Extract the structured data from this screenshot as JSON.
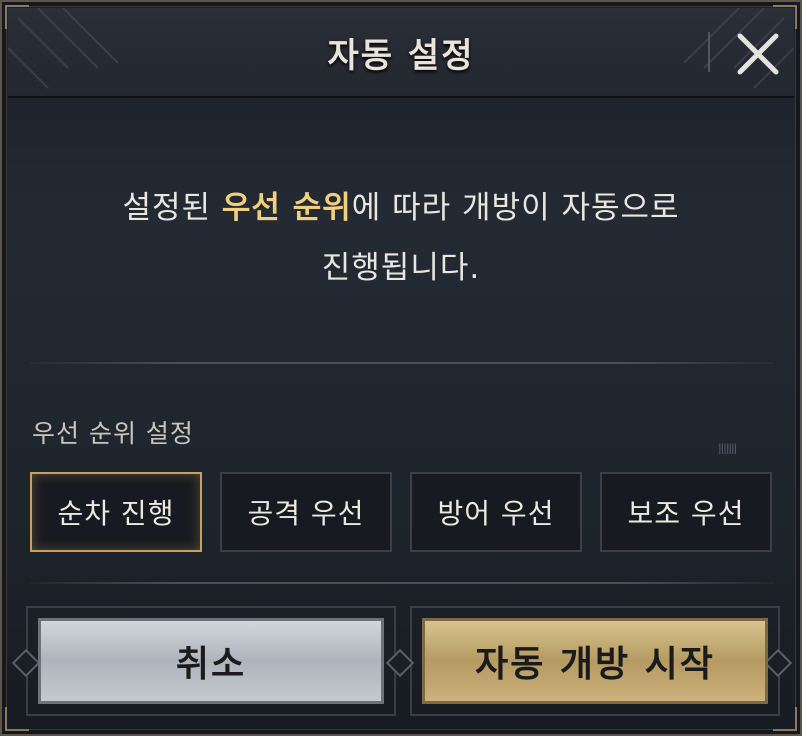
{
  "dialog": {
    "title": "자동 설정",
    "close_icon": "close-icon"
  },
  "message": {
    "before": "설정된 ",
    "highlight": "우선 순위",
    "after": "에 따라 개방이 자동으로",
    "line2": "진행됩니다."
  },
  "priority": {
    "label": "우선 순위 설정",
    "deco": "ꞁꞁꞁꞁꞁꞁꞁ",
    "options": [
      {
        "label": "순차 진행",
        "selected": true
      },
      {
        "label": "공격 우선",
        "selected": false
      },
      {
        "label": "방어 우선",
        "selected": false
      },
      {
        "label": "보조 우선",
        "selected": false
      }
    ]
  },
  "actions": {
    "cancel_label": "취소",
    "start_label": "자동 개방 시작"
  },
  "colors": {
    "highlight": "#f3cf7d",
    "selected_border": "#c9a05c",
    "start_button": "#c8b17b",
    "cancel_button": "#c0c5cc"
  }
}
